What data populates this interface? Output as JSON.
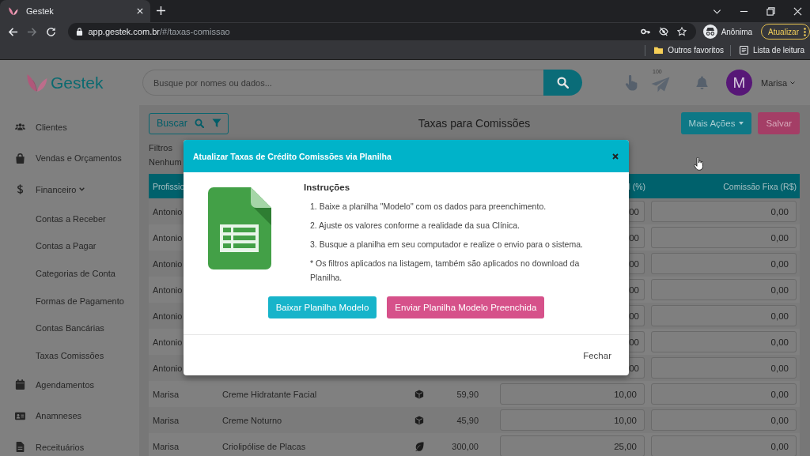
{
  "browser": {
    "tab": {
      "title": "Gestek"
    },
    "url": {
      "host": "app.gestek.com.br",
      "path": "/#/taxas-comissao"
    },
    "profile": "Anônima",
    "update_button": "Atualizar",
    "bookmarks": [
      {
        "label": "Outros favoritos"
      },
      {
        "label": "Lista de leitura"
      }
    ]
  },
  "header": {
    "logo": "Gestek",
    "search": {
      "placeholder": "Busque por nomes ou dados..."
    },
    "plane_count": "100",
    "avatar": "M",
    "user": "Marisa"
  },
  "sidebar": {
    "items": [
      {
        "label": "Clientes"
      },
      {
        "label": "Vendas e Orçamentos"
      },
      {
        "label": "Financeiro",
        "expanded": true,
        "children": [
          {
            "label": "Contas a Receber"
          },
          {
            "label": "Contas a Pagar"
          },
          {
            "label": "Categorias de Conta"
          },
          {
            "label": "Formas de Pagamento"
          },
          {
            "label": "Contas Bancárias"
          },
          {
            "label": "Taxas Comissões"
          }
        ]
      },
      {
        "label": "Agendamentos"
      },
      {
        "label": "Anamneses"
      },
      {
        "label": "Receituários"
      }
    ]
  },
  "toolbar": {
    "search_button": "Buscar",
    "title": "Taxas para Comissões",
    "actions": [
      {
        "label": "Mais Ações",
        "kind": "dropdown"
      },
      {
        "label": "Salvar",
        "kind": "save"
      }
    ]
  },
  "filters": {
    "label": "Filtros",
    "value": "Nenhum"
  },
  "table": {
    "header": {
      "column_1": "Profissio",
      "column_5": "l (%)",
      "column_6": "Comissão Fixa (R$)"
    },
    "rows": [
      {
        "kind": "hidden",
        "professional": "Antonio",
        "percent": "00",
        "fixed": "0,00"
      },
      {
        "kind": "hidden",
        "professional": "Antonio",
        "percent": "00",
        "fixed": "0,00"
      },
      {
        "kind": "hidden",
        "professional": "Antonio",
        "percent": "00",
        "fixed": "0,00"
      },
      {
        "kind": "hidden",
        "professional": "Antonio",
        "percent": "00",
        "fixed": "0,00"
      },
      {
        "kind": "hidden",
        "professional": "Antonio",
        "percent": "00",
        "fixed": "0,00"
      },
      {
        "kind": "hidden",
        "professional": "Antonio",
        "percent": "00",
        "fixed": "0,00"
      },
      {
        "kind": "hidden",
        "professional": "Antonio",
        "percent": "00",
        "fixed": "0,00"
      },
      {
        "kind": "product",
        "professional": "Marisa",
        "item": "Creme Hidratante Facial",
        "price": "59,90",
        "percent": "10,00",
        "fixed": "0,00"
      },
      {
        "kind": "product",
        "professional": "Marisa",
        "item": "Creme Noturno",
        "price": "45,90",
        "percent": "10,00",
        "fixed": "0,00"
      },
      {
        "kind": "service",
        "professional": "Marisa",
        "item": "Criolipólise de Placas",
        "price": "300,00",
        "percent": "25,00",
        "fixed": "0,00"
      }
    ]
  },
  "modal": {
    "title": "Atualizar Taxas de Crédito Comissões via Planilha",
    "heading": "Instruções",
    "steps": [
      "1. Baixe a planilha \"Modelo\" com os dados para preenchimento.",
      "2. Ajuste os valores conforme a realidade da sua Clínica.",
      "3. Busque a planilha em seu computador e realize o envio para o sistema."
    ],
    "note": "* Os filtros aplicados na listagem, também são aplicados no download da Planilha.",
    "buttons": [
      {
        "label": "Baixar Planilha Modelo",
        "kind": "download"
      },
      {
        "label": "Enviar Planilha Modelo Preenchida",
        "kind": "upload"
      }
    ],
    "close_button": "Fechar"
  }
}
